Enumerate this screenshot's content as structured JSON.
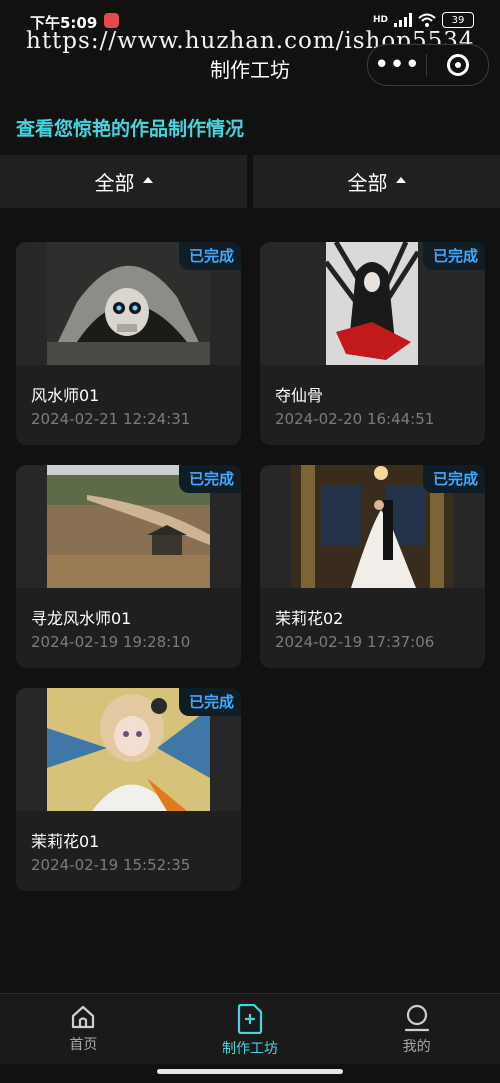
{
  "status_bar": {
    "time": "下午5:09",
    "network": "HD",
    "battery": "39"
  },
  "watermark": "https://www.huzhan.com/ishop5534",
  "nav": {
    "title": "制作工坊"
  },
  "subtitle": "查看您惊艳的作品制作情况",
  "filters": [
    {
      "label": "全部"
    },
    {
      "label": "全部"
    }
  ],
  "works": [
    {
      "title": "风水师01",
      "date": "2024-02-21 12:24:31",
      "status": "已完成"
    },
    {
      "title": "夺仙骨",
      "date": "2024-02-20 16:44:51",
      "status": "已完成"
    },
    {
      "title": "寻龙风水师01",
      "date": "2024-02-19 19:28:10",
      "status": "已完成"
    },
    {
      "title": "茉莉花02",
      "date": "2024-02-19 17:37:06",
      "status": "已完成"
    },
    {
      "title": "茉莉花01",
      "date": "2024-02-19 15:52:35",
      "status": "已完成"
    }
  ],
  "tabbar": {
    "items": [
      {
        "label": "首页",
        "icon": "home-icon",
        "active": false
      },
      {
        "label": "制作工坊",
        "icon": "create-document-icon",
        "active": true
      },
      {
        "label": "我的",
        "icon": "profile-icon",
        "active": false
      }
    ]
  },
  "colors": {
    "accent": "#46d5dc",
    "badge_text": "#3fa9ff",
    "background": "#111111",
    "card": "#1f1f1f"
  }
}
